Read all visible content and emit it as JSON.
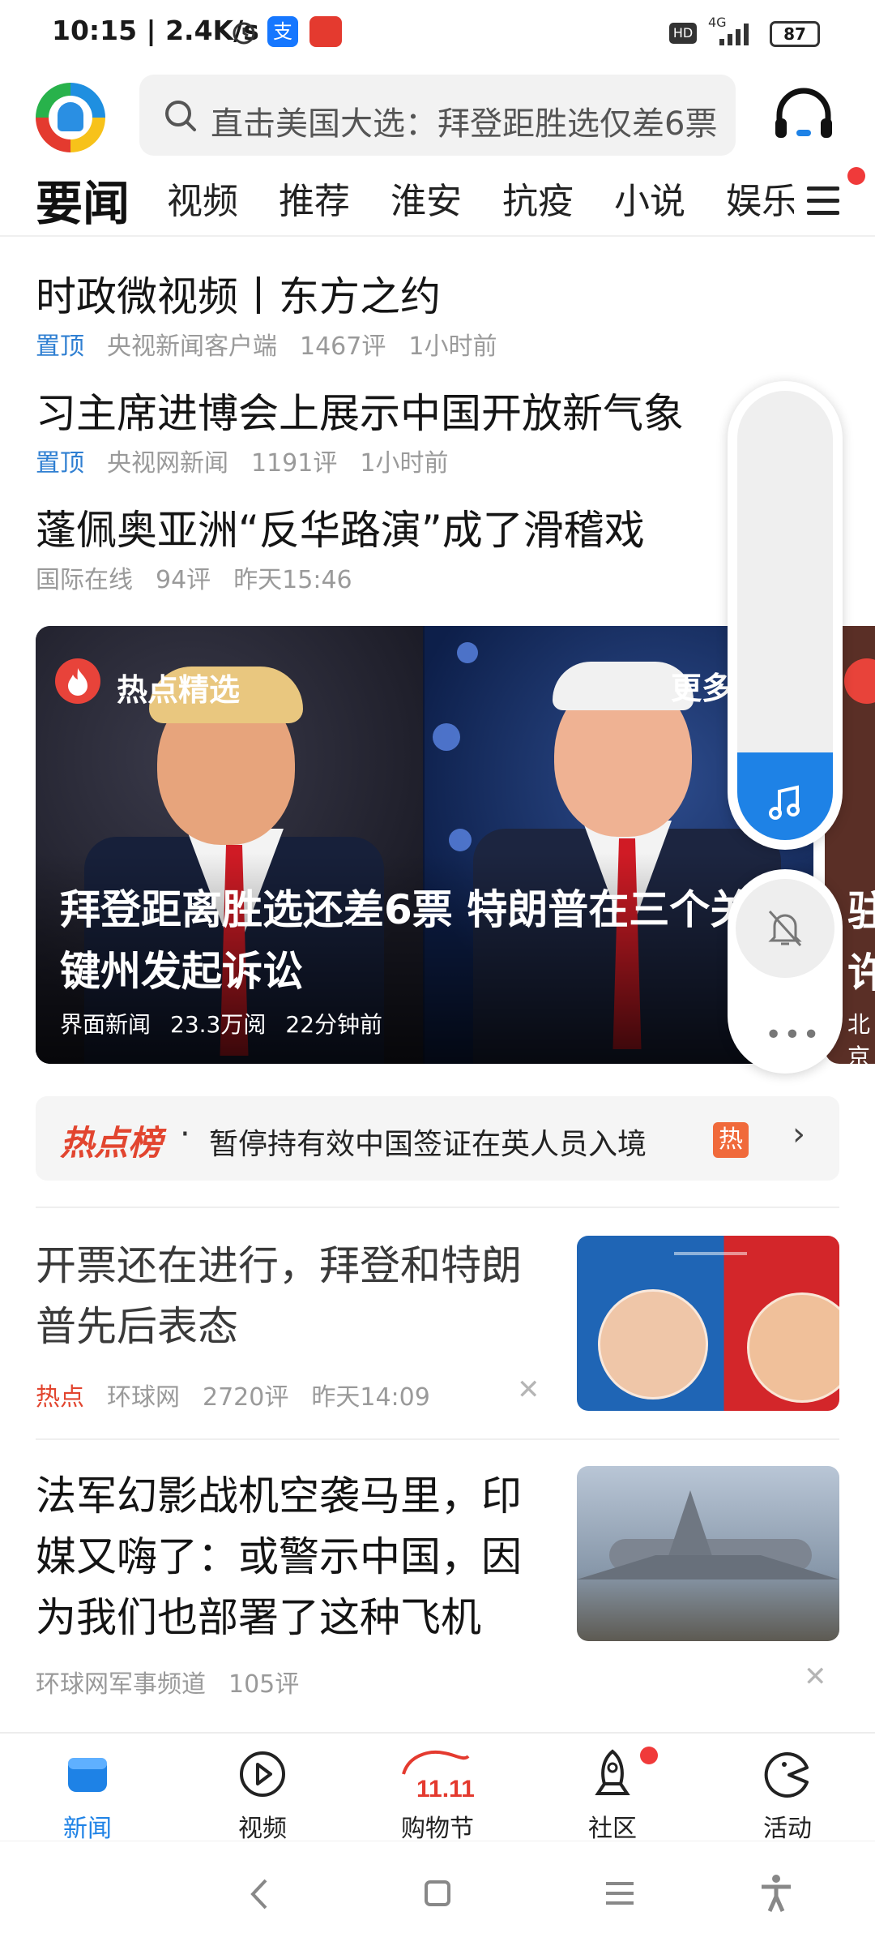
{
  "status_bar": {
    "time": "10:15 | 2.4K/s",
    "hd": "HD",
    "network": "4G",
    "battery": "87"
  },
  "header": {
    "search_placeholder": "直击美国大选：拜登距胜选仅差6票"
  },
  "tabs": [
    "要闻",
    "视频",
    "推荐",
    "淮安",
    "抗疫",
    "小说",
    "娱乐"
  ],
  "top_news": [
    {
      "title": "时政微视频丨东方之约",
      "tag": "置顶",
      "source": "央视新闻客户端",
      "comments": "1467评",
      "time": "1小时前"
    },
    {
      "title": "习主席进博会上展示中国开放新气象",
      "tag": "置顶",
      "source": "央视网新闻",
      "comments": "1191评",
      "time": "1小时前"
    },
    {
      "title": "蓬佩奥亚洲“反华路演”成了滑稽戏",
      "tag": "",
      "source": "国际在线",
      "comments": "94评",
      "time": "昨天15:46"
    }
  ],
  "carousel": {
    "section_label": "热点精选",
    "more_label": "更多",
    "title": "拜登距离胜选还差6票 特朗普在三个关键州发起诉讼",
    "source": "界面新闻",
    "reads": "23.3万阅",
    "time": "22分钟前",
    "next_peek_line1": "驻",
    "next_peek_line2": "许",
    "next_peek_meta": "北京"
  },
  "hot_list": {
    "brand": "热点榜",
    "separator": "·",
    "headline": "暂停持有效中国签证在英人员入境",
    "badge": "热"
  },
  "feed": [
    {
      "title": "开票还在进行，拜登和特朗普先后表态",
      "tag": "热点",
      "source": "环球网",
      "comments": "2720评",
      "time": "昨天14:09"
    },
    {
      "title": "法军幻影战机空袭马里，印媒又嗨了：或警示中国，因为我们也部署了这种飞机",
      "source": "环球网军事频道",
      "comments": "105评"
    }
  ],
  "bottom_nav": [
    {
      "label": "新闻",
      "icon": "news-icon",
      "active": true
    },
    {
      "label": "视频",
      "icon": "video-play-icon",
      "active": false
    },
    {
      "label": "购物节",
      "icon": "double11-icon",
      "active": false
    },
    {
      "label": "社区",
      "icon": "rocket-icon",
      "active": false
    },
    {
      "label": "活动",
      "icon": "pacman-icon",
      "active": false
    }
  ],
  "colors": {
    "accent": "#1e82e6",
    "hot": "#e2452f",
    "pin": "#2f7fd2"
  }
}
